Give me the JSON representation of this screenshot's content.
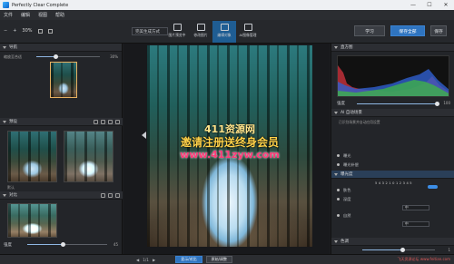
{
  "app": {
    "title": "Perfectly Clear Complete",
    "window_buttons": [
      "—",
      "☐",
      "✕"
    ]
  },
  "menu": [
    "文件",
    "编辑",
    "视图",
    "帮助"
  ],
  "toolbar": {
    "zoom": "30%",
    "zoom_minus": "−",
    "zoom_plus": "+",
    "view_mode": "完美生成方式",
    "tools": [
      "图片预览中",
      "修改图片",
      "编辑对象",
      "AI图像管理"
    ],
    "learn_label": "学习",
    "save_all_label": "保存全部",
    "export_label": "保存"
  },
  "left_panel": {
    "nav_label": "导航",
    "zoom_value_label": "缩放至合适",
    "zoom_pct": "30%",
    "zoom_level": 0.3,
    "presets_label": "预设",
    "presets_caption": "默认",
    "compare_label": "对比",
    "strength_label": "强度",
    "strength_value": "45",
    "strength_level": 0.45
  },
  "canvas": {
    "watermark_1": "411资源网",
    "watermark_2": "邀请注册送终身会员",
    "watermark_3": "www.411zyw.com"
  },
  "right_panel": {
    "histogram_label": "直方图",
    "strength_label": "强度",
    "strength_value": "100",
    "strength_level": 1.0,
    "ai_section": "AI 自动场景",
    "ai_desc": "已识别场景并自动应用设置",
    "rows": [
      {
        "label": "曝光",
        "value": ""
      },
      {
        "label": "曝光补偿",
        "value": ""
      },
      {
        "label": "肤色",
        "value": ""
      },
      {
        "label": "深度",
        "value": ""
      },
      {
        "label": "自然",
        "value": ""
      }
    ],
    "exposure_label": "曝光度",
    "exposure_scale": "5 4 3 2 1 0 1 2 3 4 5",
    "contrast_label": "对比度",
    "sharpen_label": "锐化",
    "sel_1": "中",
    "sel_2": "中",
    "color_section": "色调",
    "color_value": "1",
    "color_level": 0.55
  },
  "status": {
    "nav_prev": "◀",
    "nav_next": "▶",
    "btn_1": "显示/对比",
    "btn_2": "原始/调整",
    "page": "1/1",
    "right_text": "飞天资源论坛 www.feitian.com"
  },
  "colors": {
    "accent": "#2f74c0",
    "panel": "#232529",
    "canvas": "#18191c"
  }
}
